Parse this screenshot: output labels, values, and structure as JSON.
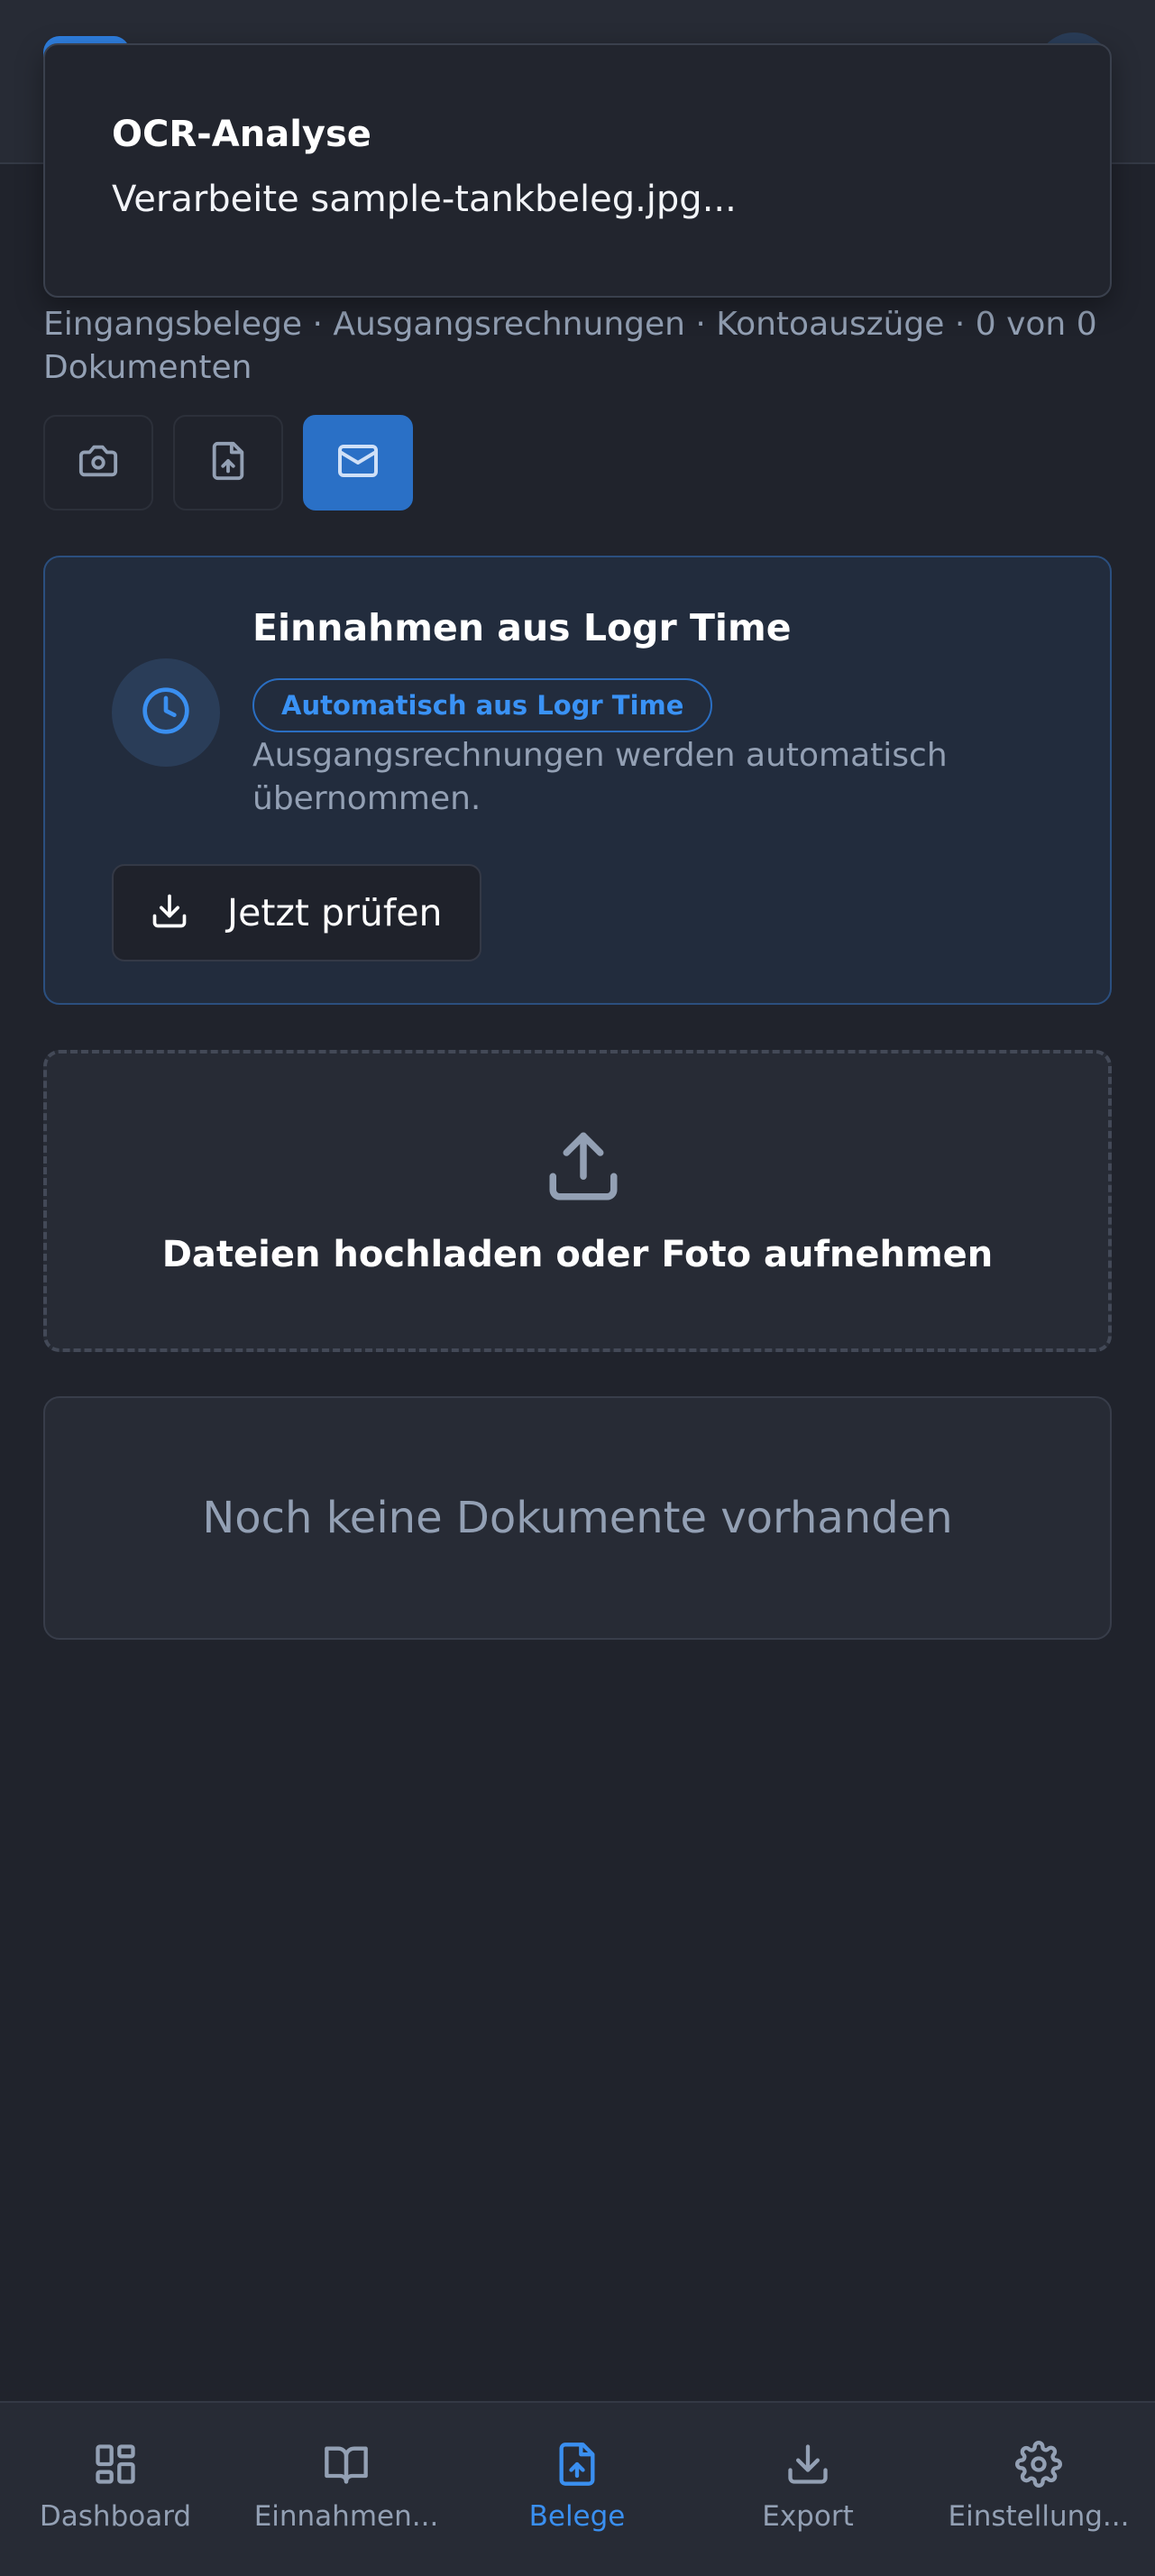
{
  "toast": {
    "title": "OCR-Analyse",
    "description": "Verarbeite sample-tankbeleg.jpg..."
  },
  "page": {
    "subtitle": "Eingangsbelege · Ausgangsrechnungen · Kontoauszüge · 0 von 0 Dokumenten"
  },
  "actions": [
    {
      "icon": "camera-icon",
      "active": false
    },
    {
      "icon": "file-upload-icon",
      "active": false
    },
    {
      "icon": "mail-icon",
      "active": true
    }
  ],
  "logr_card": {
    "title": "Einnahmen aus Logr Time",
    "badge": "Automatisch aus Logr Time",
    "description": "Ausgangsrechnungen werden automatisch übernommen.",
    "button_label": "Jetzt prüfen",
    "icon": "clock-icon"
  },
  "dropzone": {
    "label": "Dateien hochladen oder Foto aufnehmen",
    "icon": "upload-icon"
  },
  "empty_state": {
    "text": "Noch keine Dokumente vorhanden"
  },
  "bottom_nav": {
    "items": [
      {
        "label": "Dashboard",
        "icon": "dashboard-icon",
        "active": false
      },
      {
        "label": "Einnahmen...",
        "icon": "book-icon",
        "active": false
      },
      {
        "label": "Belege",
        "icon": "file-upload-icon",
        "active": true
      },
      {
        "label": "Export",
        "icon": "download-icon",
        "active": false
      },
      {
        "label": "Einstellung...",
        "icon": "gear-icon",
        "active": false
      }
    ]
  },
  "colors": {
    "accent": "#3a8ff0",
    "background": "#20232c",
    "muted_text": "#93a0b4"
  }
}
